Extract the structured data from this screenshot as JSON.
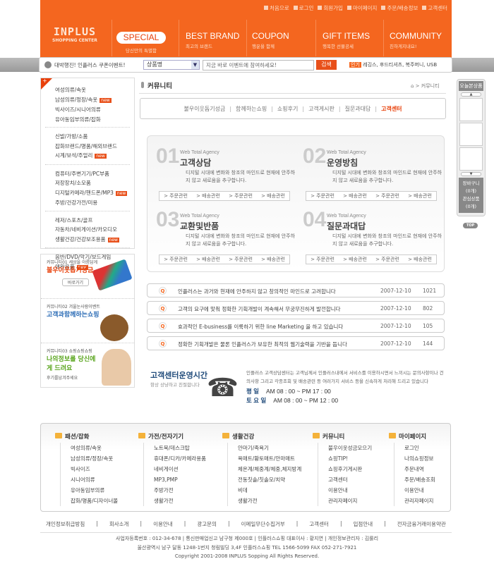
{
  "header": {
    "top_links": [
      "처음으로",
      "로그인",
      "회원가입",
      "마이페이지",
      "주문/배송정보",
      "고객센터"
    ],
    "logo": {
      "title": "INPLUS",
      "sub": "SHOPPING CENTER"
    },
    "nav": [
      {
        "label": "SPECIAL",
        "sub": "당신만의 특별함"
      },
      {
        "label": "BEST BRAND",
        "sub": "최고의 브랜드"
      },
      {
        "label": "COUPON",
        "sub": "행운을 함께"
      },
      {
        "label": "GIFT ITEMS",
        "sub": "행복한 선물공세"
      },
      {
        "label": "COMMUNITY",
        "sub": "친하게지내요!"
      }
    ],
    "accent": "#f4661f"
  },
  "search": {
    "event": "대박행진! 인플러스 쿠폰이벤트!",
    "select": "상품명",
    "placeholder": "지금 바로 이벤트에 참여하세요!",
    "button": "검색",
    "popular_label": "인기",
    "popular": "레깅스, 후드티셔츠, 복주머니, USB"
  },
  "sidebar": {
    "groups": [
      [
        {
          "label": "여성의류/속옷"
        },
        {
          "label": "남성의류/정장/속옷",
          "new": "new"
        },
        {
          "label": "빅사이즈/시니어의류"
        },
        {
          "label": "유아동임부의류/잡화"
        }
      ],
      [
        {
          "label": "신발/가방/소품"
        },
        {
          "label": "잡화브랜드/명품/해외브랜드"
        },
        {
          "label": "시계/보석/주얼리",
          "new": "new"
        }
      ],
      [
        {
          "label": "컴퓨터/주변기기/PC부품"
        },
        {
          "label": "저장장치/소모품"
        },
        {
          "label": "디지털카메라/핸드폰/MP3",
          "new": "new"
        },
        {
          "label": "주방/건강가전/미용"
        }
      ],
      [
        {
          "label": "레저/스포츠/골프"
        },
        {
          "label": "자동차/네비게이션/카오디오"
        },
        {
          "label": "생활건강/건강보조용품",
          "new": "new"
        }
      ],
      [
        {
          "label": "음반/DVD/악기/보드게임"
        },
        {
          "label": "애완용품",
          "new": "new"
        }
      ]
    ]
  },
  "banners": [
    {
      "small": "커뮤니티01 세상을 아름답게",
      "big": "불우이웃돕기성금",
      "button": "바로가기",
      "color": "#e8400a"
    },
    {
      "small": "커뮤니티02 겨울눈사람이벤트",
      "big": "고객과함께하는쇼핑",
      "color": "#2a6bb5"
    },
    {
      "small": "커뮤니티03 쇼핑쇼핑쇼핑",
      "big": "나의정보를 당신에게 드려요",
      "extra": "후기를남겨주세요",
      "color": "#5aa51e"
    }
  ],
  "main": {
    "title": "커뮤니티",
    "breadcrumb": "⌂ > 커뮤니티",
    "tabs": [
      {
        "label": "불우이웃돕기성금"
      },
      {
        "label": "함께하는쇼핑"
      },
      {
        "label": "쇼핑후기"
      },
      {
        "label": "고객게시판"
      },
      {
        "label": "질문과대답"
      },
      {
        "label": "고객센터",
        "active": true
      }
    ],
    "cards": [
      {
        "num": "01",
        "agency": "Web Total Agency",
        "title": "고객상담"
      },
      {
        "num": "02",
        "agency": "Web Total Agency",
        "title": "운영방침"
      },
      {
        "num": "03",
        "agency": "Web Total Agency",
        "title": "교환및반품"
      },
      {
        "num": "04",
        "agency": "Web Total Agency",
        "title": "질문과대답"
      }
    ],
    "card_desc": "디지털 시대에 변화와 창조의 마인드로 현재에 안주하지 않고 새로움을 추구합니다.",
    "card_links": [
      "> 주문관련",
      "> 배송관련",
      "> 주문관련",
      "> 배송관련"
    ],
    "faq": [
      {
        "text": "인플러스는 과거와 현재에 안주하지 않고 창의적인 마인드로 고려합니다",
        "date": "2007-12-10",
        "count": "1021"
      },
      {
        "text": "고객의 요구에 맞춰 정확한 기획개발이 계속해서 무궁무진하게 발전합니다",
        "date": "2007-12-10",
        "count": "802"
      },
      {
        "text": "효과적인 E-business를 이룩하기 위한 line Marketing 을 하고 있습니다",
        "date": "2007-12-10",
        "count": "105"
      },
      {
        "text": "정확한 기획개발은 물론 인플러스가 보유한 최적의 웹기술력을 기반을 둡니다",
        "date": "2007-12-10",
        "count": "144"
      }
    ],
    "cs": {
      "title": "고객센터운영시간",
      "sub": "항상 상냥하고 친절합니다",
      "desc": "인플러스 고객상담센터는 고객님께서 인플러스내에서 서비스를 이용하시면서 느끼시는 문의사항이나 건의사항 그리고 각종조회 및 배송관련 등 여러가지 서비스 등을 신속하게 처리해 드리고 있습니다",
      "weekday_label": "평  일",
      "weekday": "AM 08 : 00 ~ PM 17 : 00",
      "sat_label": "토 요 일",
      "sat": "AM 08 : 00 ~ PM 12 : 00"
    }
  },
  "sitemap": [
    {
      "title": "패션/잡화",
      "items": [
        "여성의류/속옷",
        "남성의류/정장/속옷",
        "빅사이즈",
        "시니어의류",
        "유아동임부의류",
        "잡화/명품/디자이너몰"
      ]
    },
    {
      "title": "가전/전자기기",
      "items": [
        "노트북/데스크탑",
        "휴대폰/디카/카메라용품",
        "네비게이션",
        "MP3,PMP",
        "주방가전",
        "생활가전"
      ]
    },
    {
      "title": "생활건강",
      "items": [
        "안마기/족욕기",
        "욕매트/황토매트/안마매트",
        "체온계/체중계/체중,체지방계",
        "전동칫솔/칫솔모/치약",
        "비데",
        "생활가전"
      ]
    },
    {
      "title": "커뮤니티",
      "items": [
        "불우이웃성금모으기",
        "쇼핑TIP!",
        "쇼핑후기게시판",
        "고객센터",
        "이용안내",
        "관리자페이지"
      ]
    },
    {
      "title": "마이페이지",
      "items": [
        "로그인",
        "나의쇼핑정보",
        "주문내역",
        "주문/배송조회",
        "이용안내",
        "관리자페이지"
      ]
    }
  ],
  "footer": {
    "links": [
      "개인정보취급방침",
      "회사소개",
      "이용안내",
      "광고문의",
      "이메일무단수집거부",
      "고객센터",
      "입점안내",
      "전자금융거래이용약관"
    ],
    "line1": "사업자등록번호 : 012-34-678  |  통신판매업신고 남구청 제000호  |  인플러스쇼핑 대표이사 : 황지연  |  개인정보관리자 : 김룰리",
    "line2": "울산광역시 남구 달동 1248-1번지 청림빌딩 3,4F 인플러스쇼핑 TEL 1566-5099  FAX 052-271-7921",
    "copyright": "Copyright 2001-2008 INPLUS Sopping All Rights Reserved."
  },
  "quick": {
    "title": "오늘본상품",
    "cart": "장바구니",
    "cart_count": "(0개)",
    "wish": "관심상품",
    "wish_count": "(0개)",
    "top": "TOP"
  }
}
